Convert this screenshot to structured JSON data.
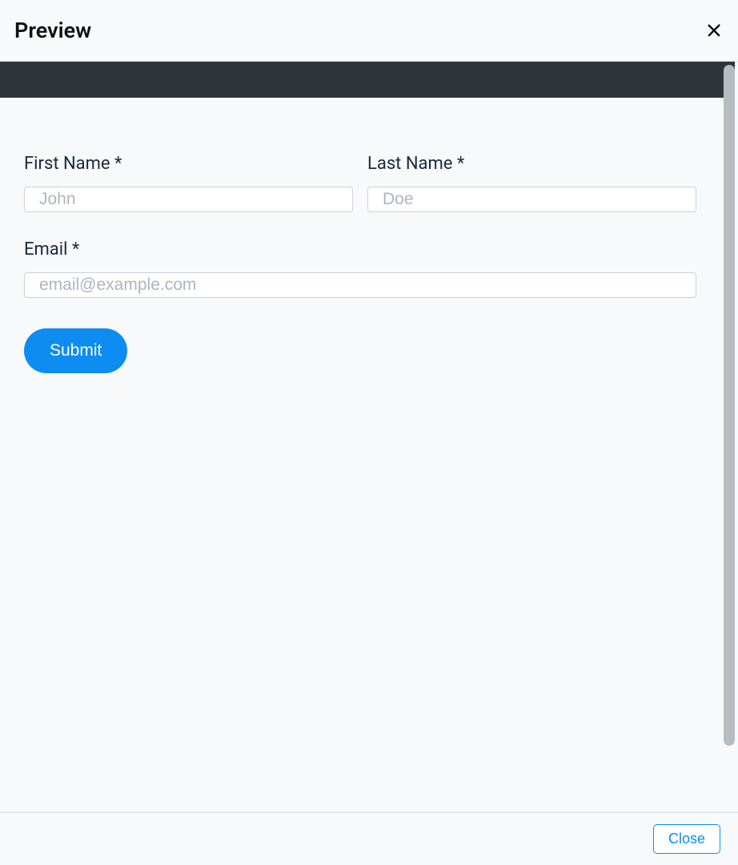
{
  "header": {
    "title": "Preview"
  },
  "form": {
    "fields": {
      "first_name": {
        "label": "First Name *",
        "placeholder": "John"
      },
      "last_name": {
        "label": "Last Name *",
        "placeholder": "Doe"
      },
      "email": {
        "label": "Email *",
        "placeholder": "email@example.com"
      }
    },
    "submit_label": "Submit"
  },
  "footer": {
    "close_label": "Close"
  }
}
